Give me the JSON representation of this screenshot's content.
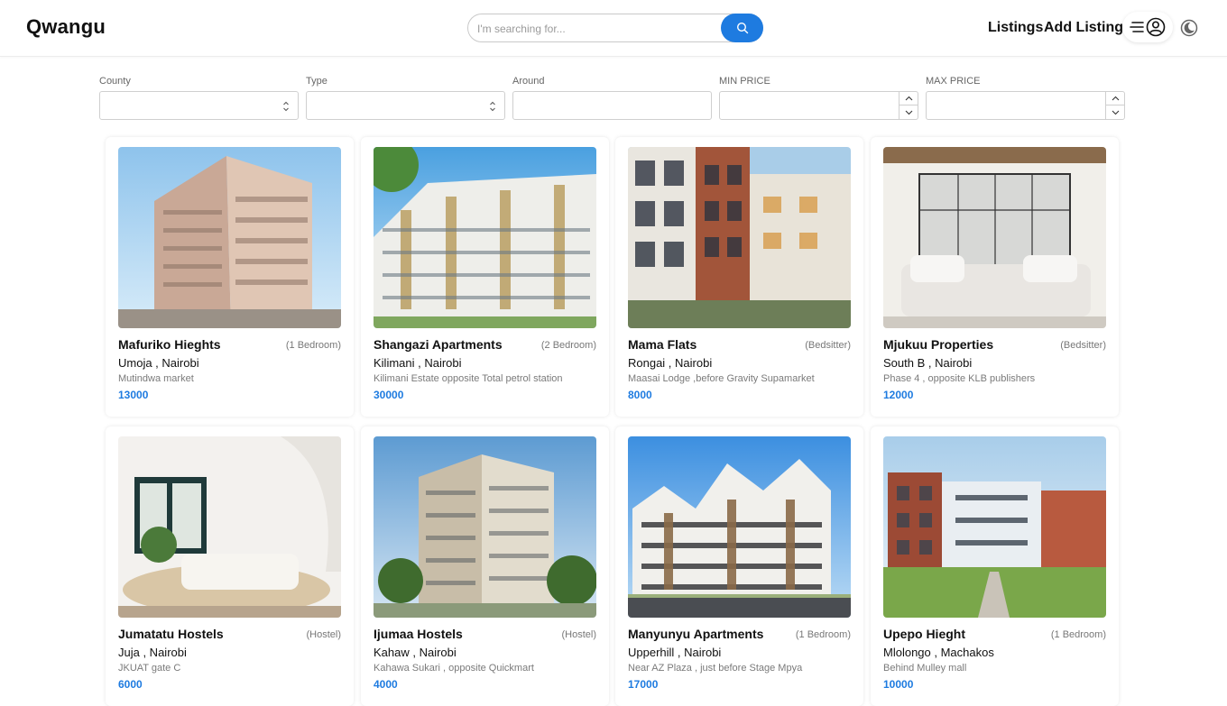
{
  "header": {
    "brand": "Qwangu",
    "search_placeholder": "I'm searching for...",
    "nav": {
      "listings": "Listings",
      "add_listing": "Add Listing"
    },
    "accent": "#1e7be0"
  },
  "filters": {
    "county": {
      "label": "County",
      "value": ""
    },
    "type": {
      "label": "Type",
      "value": ""
    },
    "around": {
      "label": "Around",
      "value": ""
    },
    "min_price": {
      "label": "MIN PRICE",
      "value": ""
    },
    "max_price": {
      "label": "MAX PRICE",
      "value": ""
    }
  },
  "listings": [
    {
      "title": "Mafuriko Hieghts",
      "type": "(1 Bedroom)",
      "location": "Umoja , Nairobi",
      "description": "Mutindwa market",
      "price": "13000"
    },
    {
      "title": "Shangazi Apartments",
      "type": "(2 Bedroom)",
      "location": "Kilimani , Nairobi",
      "description": "Kilimani Estate opposite Total petrol station",
      "price": "30000"
    },
    {
      "title": "Mama Flats",
      "type": "(Bedsitter)",
      "location": "Rongai , Nairobi",
      "description": "Maasai Lodge ,before Gravity Supamarket",
      "price": "8000"
    },
    {
      "title": "Mjukuu Properties",
      "type": "(Bedsitter)",
      "location": "South B , Nairobi",
      "description": "Phase 4 , opposite KLB publishers",
      "price": "12000"
    },
    {
      "title": "Jumatatu Hostels",
      "type": "(Hostel)",
      "location": "Juja , Nairobi",
      "description": "JKUAT gate C",
      "price": "6000"
    },
    {
      "title": "Ijumaa Hostels",
      "type": "(Hostel)",
      "location": "Kahaw , Nairobi",
      "description": "Kahawa Sukari , opposite Quickmart",
      "price": "4000"
    },
    {
      "title": "Manyunyu Apartments",
      "type": "(1 Bedroom)",
      "location": "Upperhill , Nairobi",
      "description": "Near AZ Plaza , just before Stage Mpya",
      "price": "17000"
    },
    {
      "title": "Upepo Hieght",
      "type": "(1 Bedroom)",
      "location": "Mlolongo , Machakos",
      "description": "Behind Mulley mall",
      "price": "10000"
    }
  ]
}
